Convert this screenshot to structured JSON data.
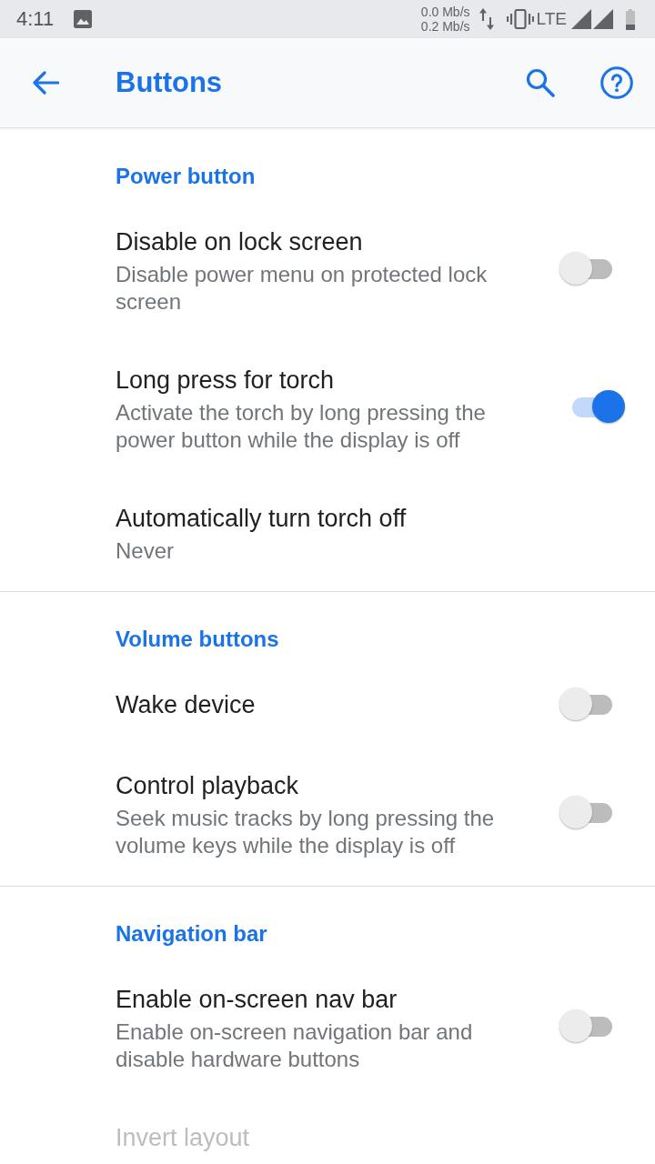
{
  "status_bar": {
    "time": "4:11",
    "speeds": [
      "0.0 Mb/s",
      "0.2 Mb/s"
    ],
    "network": "LTE"
  },
  "app_bar": {
    "title": "Buttons"
  },
  "sections": [
    {
      "title": "Power button",
      "items": [
        {
          "kind": "switch",
          "title": "Disable on lock screen",
          "summary": "Disable power menu on protected lock screen",
          "on": false,
          "disabled": false
        },
        {
          "kind": "switch",
          "title": "Long press for torch",
          "summary": "Activate the torch by long pressing the power button while the display is off",
          "on": true,
          "disabled": false
        },
        {
          "kind": "text",
          "title": "Automatically turn torch off",
          "summary": "Never",
          "disabled": false
        }
      ]
    },
    {
      "title": "Volume buttons",
      "items": [
        {
          "kind": "switch",
          "title": "Wake device",
          "on": false,
          "disabled": false
        },
        {
          "kind": "switch",
          "title": "Control playback",
          "summary": "Seek music tracks by long pressing the volume keys while the display is off",
          "on": false,
          "disabled": false
        }
      ]
    },
    {
      "title": "Navigation bar",
      "items": [
        {
          "kind": "switch",
          "title": "Enable on-screen nav bar",
          "summary": "Enable on-screen navigation bar and disable hardware buttons",
          "on": false,
          "disabled": false
        },
        {
          "kind": "text",
          "title": "Invert layout",
          "disabled": true
        }
      ]
    }
  ]
}
